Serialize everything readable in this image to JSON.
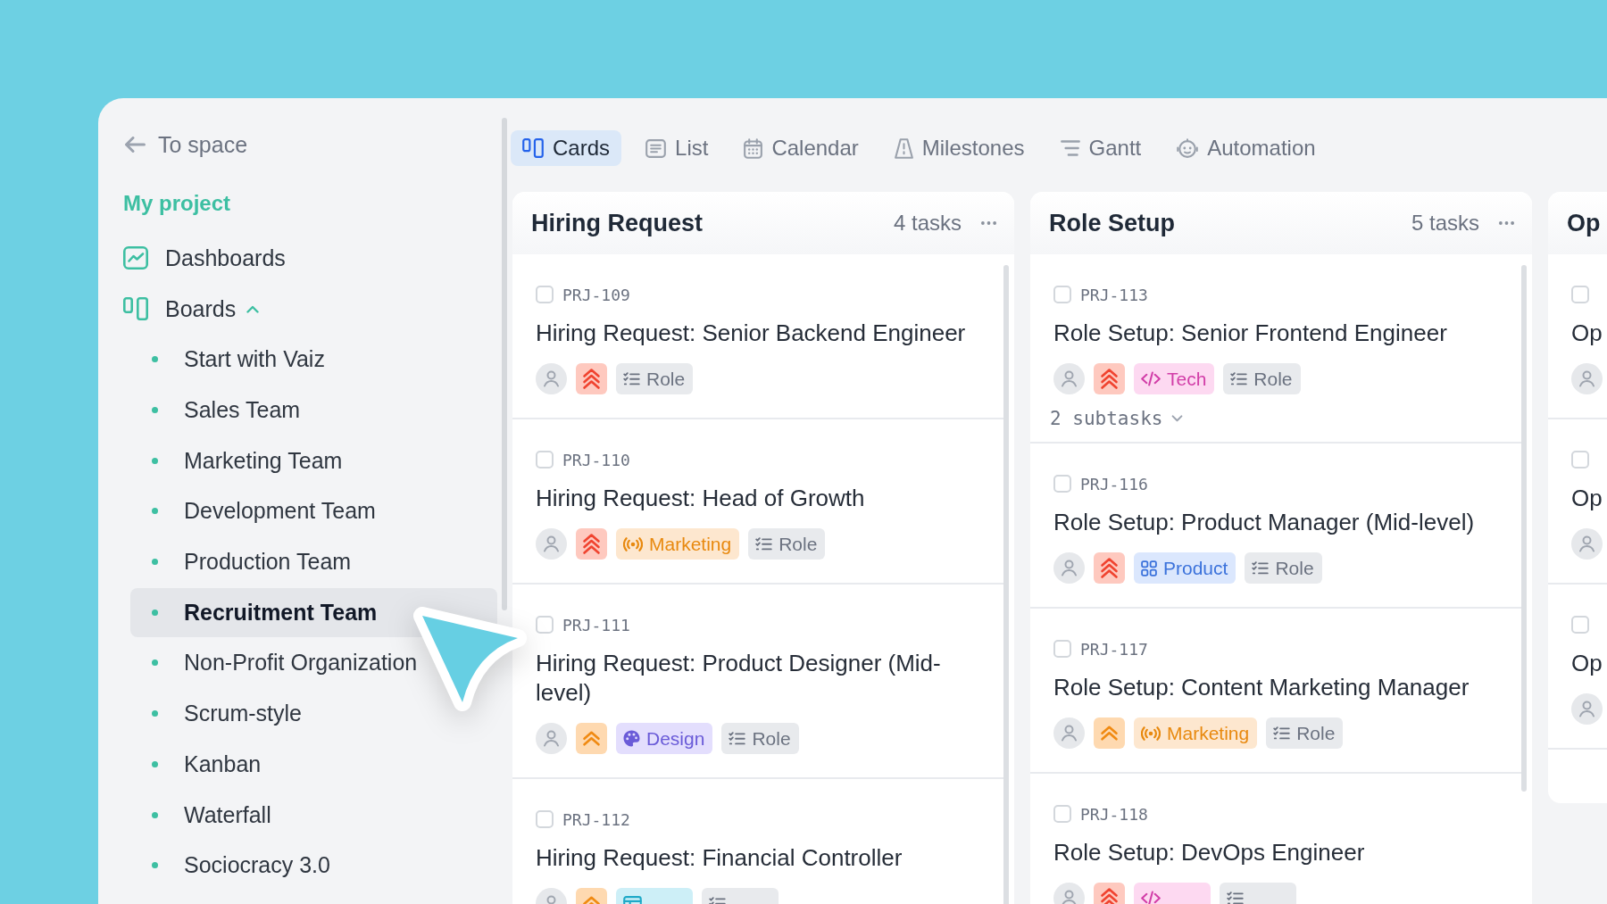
{
  "sidebar": {
    "back_link": "To space",
    "project": "My project",
    "items": [
      {
        "kind": "dashboards",
        "label": "Dashboards"
      },
      {
        "kind": "boards",
        "label": "Boards",
        "expanded": true,
        "children": [
          {
            "label": "Start with Vaiz",
            "selected": false
          },
          {
            "label": "Sales Team",
            "selected": false
          },
          {
            "label": "Marketing Team",
            "selected": false
          },
          {
            "label": "Development Team",
            "selected": false
          },
          {
            "label": "Production Team",
            "selected": false
          },
          {
            "label": "Recruitment Team",
            "selected": true
          },
          {
            "label": "Non-Profit Organization",
            "selected": false
          },
          {
            "label": "Scrum-style",
            "selected": false
          },
          {
            "label": "Kanban",
            "selected": false
          },
          {
            "label": "Waterfall",
            "selected": false
          },
          {
            "label": "Sociocracy 3.0",
            "selected": false
          }
        ]
      }
    ]
  },
  "view_tabs": [
    {
      "kind": "cards",
      "label": "Cards",
      "selected": true
    },
    {
      "kind": "list",
      "label": "List",
      "selected": false
    },
    {
      "kind": "calendar",
      "label": "Calendar",
      "selected": false
    },
    {
      "kind": "milestones",
      "label": "Milestones",
      "selected": false
    },
    {
      "kind": "gantt",
      "label": "Gantt",
      "selected": false
    },
    {
      "kind": "automation",
      "label": "Automation",
      "selected": false
    }
  ],
  "columns": [
    {
      "title": "Hiring Request",
      "count": "4 tasks",
      "cards": [
        {
          "id": "PRJ-109",
          "checked": false,
          "title": "Hiring Request: Senior Backend Engineer",
          "priority": {
            "kind": "highest"
          },
          "tags": [
            {
              "kind": "role",
              "label": "Role"
            }
          ]
        },
        {
          "id": "PRJ-110",
          "checked": false,
          "title": "Hiring Request: Head of Growth",
          "priority": {
            "kind": "highest"
          },
          "tags": [
            {
              "kind": "marketing",
              "label": "Marketing"
            },
            {
              "kind": "role",
              "label": "Role"
            }
          ]
        },
        {
          "id": "PRJ-111",
          "checked": false,
          "title": "Hiring Request: Product Designer (Mid-level)",
          "priority": {
            "kind": "high"
          },
          "tags": [
            {
              "kind": "design",
              "label": "Design"
            },
            {
              "kind": "role",
              "label": "Role"
            }
          ]
        },
        {
          "id": "PRJ-112",
          "checked": false,
          "title": "Hiring Request: Financial Controller",
          "priority": {
            "kind": "high"
          },
          "tags": [
            {
              "kind": "finance"
            },
            {
              "kind": "role"
            }
          ]
        }
      ]
    },
    {
      "title": "Role Setup",
      "count": "5 tasks",
      "cards": [
        {
          "id": "PRJ-113",
          "checked": false,
          "title": "Role Setup: Senior Frontend Engineer",
          "priority": {
            "kind": "highest"
          },
          "tags": [
            {
              "kind": "tech",
              "label": "Tech"
            },
            {
              "kind": "role",
              "label": "Role"
            }
          ],
          "subtasks": {
            "label": "2 subtasks",
            "expanded": false
          }
        },
        {
          "id": "PRJ-116",
          "checked": false,
          "title": "Role Setup: Product Manager (Mid-level)",
          "priority": {
            "kind": "highest"
          },
          "tags": [
            {
              "kind": "product",
              "label": "Product"
            },
            {
              "kind": "role",
              "label": "Role"
            }
          ]
        },
        {
          "id": "PRJ-117",
          "checked": false,
          "title": "Role Setup: Content Marketing Manager",
          "priority": {
            "kind": "high"
          },
          "tags": [
            {
              "kind": "marketing",
              "label": "Marketing"
            },
            {
              "kind": "role",
              "label": "Role"
            }
          ]
        },
        {
          "id": "PRJ-118",
          "checked": false,
          "title": "Role Setup: DevOps Engineer",
          "priority": {
            "kind": "highest"
          },
          "tags": [
            {
              "kind": "tech"
            },
            {
              "kind": "role"
            }
          ]
        }
      ]
    },
    {
      "title": "Op",
      "cards": [
        {
          "checked": false,
          "title": "Op"
        },
        {
          "checked": false,
          "title": "Op"
        },
        {
          "checked": false,
          "title": "Op"
        }
      ]
    }
  ]
}
